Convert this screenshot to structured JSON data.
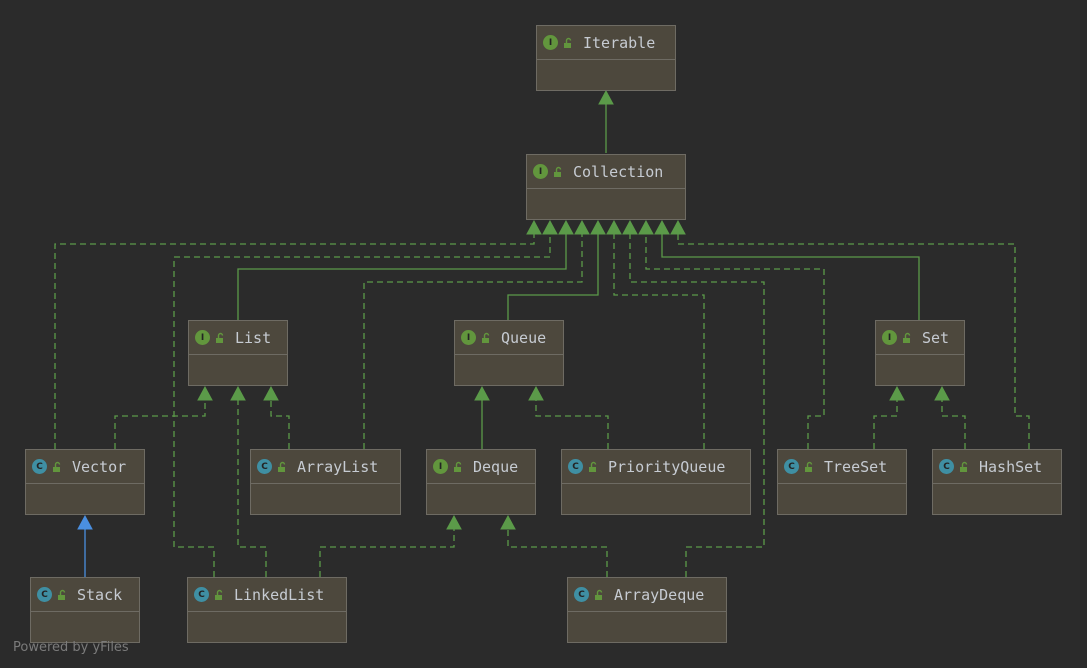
{
  "diagram": {
    "colors": {
      "background": "#2b2b2b",
      "node_fill": "#4d483d",
      "node_border": "#6e6b63",
      "label": "#c6cbd2",
      "interface_badge": "#62963d",
      "class_badge": "#3f8fa3",
      "implements_edge": "#5b9a49",
      "extends_edge": "#5b9a49",
      "class_extends_edge": "#4a8fe0"
    },
    "nodes": {
      "iterable": {
        "label": "Iterable",
        "kind": "I",
        "badge_icon": "interface-icon",
        "access_icon": "unlocked-icon"
      },
      "collection": {
        "label": "Collection",
        "kind": "I",
        "badge_icon": "interface-icon",
        "access_icon": "unlocked-icon"
      },
      "list": {
        "label": "List",
        "kind": "I",
        "badge_icon": "interface-icon",
        "access_icon": "unlocked-icon"
      },
      "queue": {
        "label": "Queue",
        "kind": "I",
        "badge_icon": "interface-icon",
        "access_icon": "unlocked-icon"
      },
      "set": {
        "label": "Set",
        "kind": "I",
        "badge_icon": "interface-icon",
        "access_icon": "unlocked-icon"
      },
      "vector": {
        "label": "Vector",
        "kind": "C",
        "badge_icon": "class-icon",
        "access_icon": "unlocked-icon"
      },
      "arraylist": {
        "label": "ArrayList",
        "kind": "C",
        "badge_icon": "class-icon",
        "access_icon": "unlocked-icon"
      },
      "deque": {
        "label": "Deque",
        "kind": "I",
        "badge_icon": "interface-icon",
        "access_icon": "unlocked-icon"
      },
      "priorityqueue": {
        "label": "PriorityQueue",
        "kind": "C",
        "badge_icon": "class-icon",
        "access_icon": "unlocked-icon"
      },
      "treeset": {
        "label": "TreeSet",
        "kind": "C",
        "badge_icon": "class-icon",
        "access_icon": "unlocked-icon"
      },
      "hashset": {
        "label": "HashSet",
        "kind": "C",
        "badge_icon": "class-icon",
        "access_icon": "unlocked-icon"
      },
      "stack": {
        "label": "Stack",
        "kind": "C",
        "badge_icon": "class-icon",
        "access_icon": "unlocked-icon"
      },
      "linkedlist": {
        "label": "LinkedList",
        "kind": "C",
        "badge_icon": "class-icon",
        "access_icon": "unlocked-icon"
      },
      "arraydeque": {
        "label": "ArrayDeque",
        "kind": "C",
        "badge_icon": "class-icon",
        "access_icon": "unlocked-icon"
      }
    },
    "edges": [
      {
        "from": "collection",
        "to": "iterable",
        "style": "solid"
      },
      {
        "from": "vector",
        "to": "collection",
        "style": "dashed"
      },
      {
        "from": "linkedlist",
        "to": "collection",
        "style": "dashed"
      },
      {
        "from": "list",
        "to": "collection",
        "style": "solid"
      },
      {
        "from": "arraylist",
        "to": "collection",
        "style": "dashed"
      },
      {
        "from": "queue",
        "to": "collection",
        "style": "solid"
      },
      {
        "from": "priorityqueue",
        "to": "collection",
        "style": "dashed"
      },
      {
        "from": "arraydeque",
        "to": "collection",
        "style": "dashed"
      },
      {
        "from": "treeset",
        "to": "collection",
        "style": "dashed"
      },
      {
        "from": "set",
        "to": "collection",
        "style": "solid"
      },
      {
        "from": "hashset",
        "to": "collection",
        "style": "dashed"
      },
      {
        "from": "vector",
        "to": "list",
        "style": "dashed"
      },
      {
        "from": "linkedlist",
        "to": "list",
        "style": "dashed"
      },
      {
        "from": "arraylist",
        "to": "list",
        "style": "dashed"
      },
      {
        "from": "deque",
        "to": "queue",
        "style": "solid"
      },
      {
        "from": "priorityqueue",
        "to": "queue",
        "style": "dashed"
      },
      {
        "from": "treeset",
        "to": "set",
        "style": "dashed"
      },
      {
        "from": "hashset",
        "to": "set",
        "style": "dashed"
      },
      {
        "from": "stack",
        "to": "vector",
        "style": "class-extends"
      },
      {
        "from": "linkedlist",
        "to": "deque",
        "style": "dashed"
      },
      {
        "from": "arraydeque",
        "to": "deque",
        "style": "dashed"
      }
    ]
  },
  "footer": {
    "text": "Powered by yFiles"
  }
}
